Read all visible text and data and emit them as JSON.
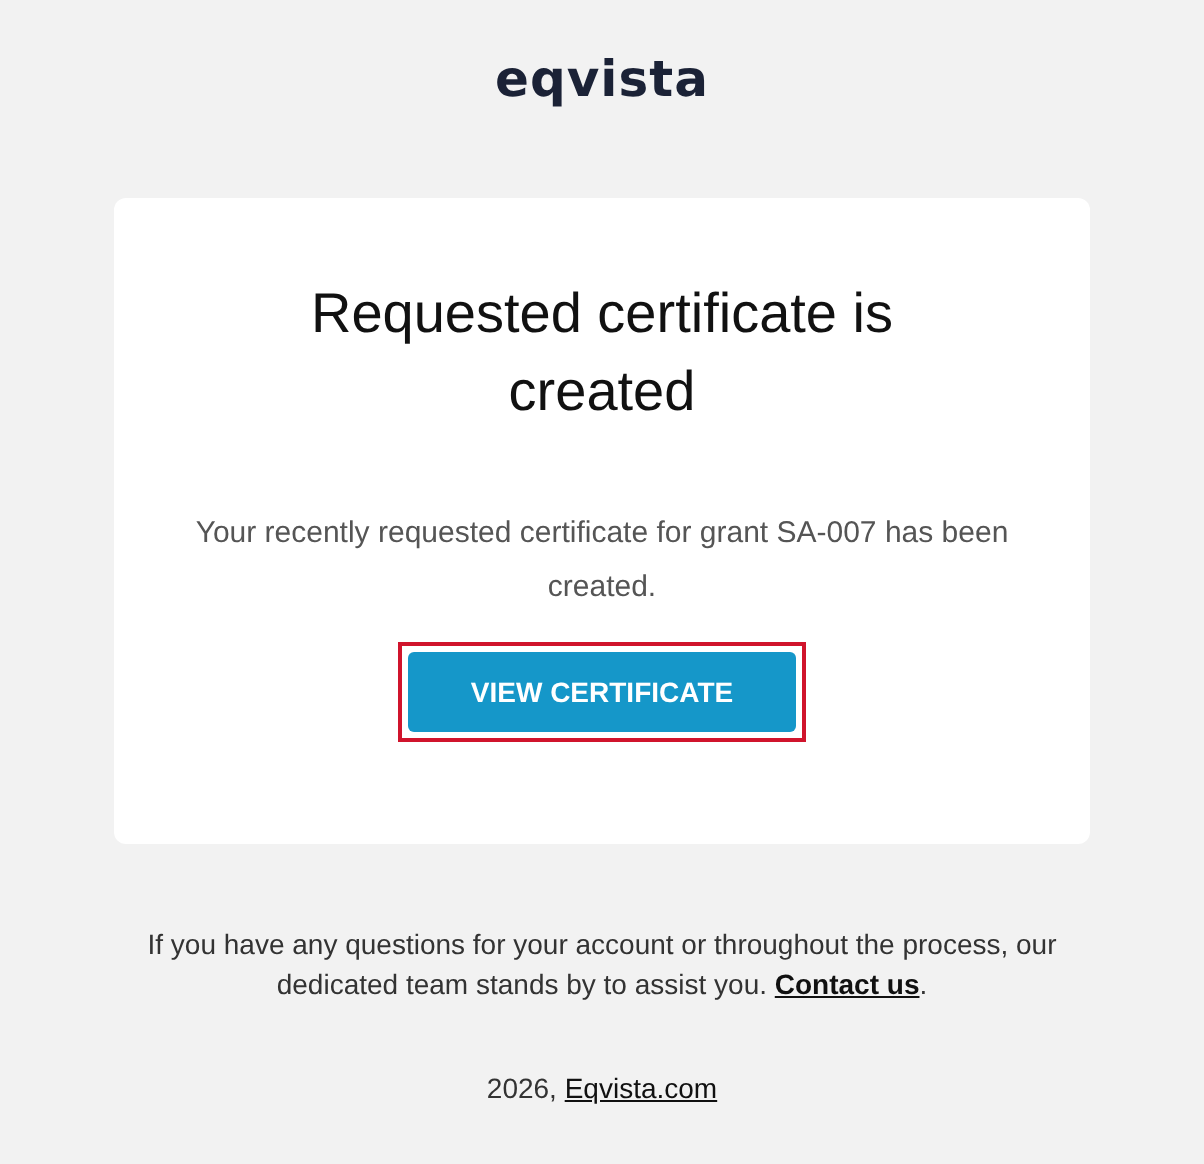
{
  "logo": "eqvista",
  "card": {
    "title": "Requested certificate is created",
    "message": "Your recently requested certificate for grant SA-007 has been created.",
    "button": {
      "label": "VIEW CERTIFICATE",
      "highlighted": true
    }
  },
  "footer": {
    "note": "If you have any questions for your account or throughout the process, our dedicated team stands by to assist you.",
    "note_link": "Contact us",
    "note_end": ".",
    "copyright": "2026,",
    "copyright_link": "Eqvista.com"
  }
}
